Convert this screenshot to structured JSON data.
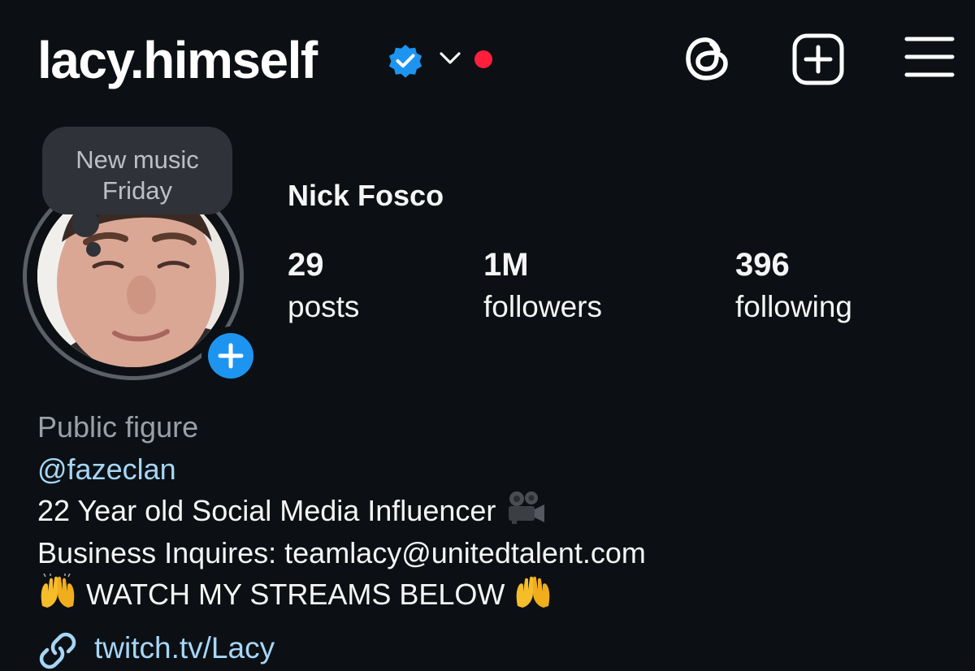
{
  "header": {
    "username": "lacy.himself",
    "icons": {
      "verified": "verified-badge-icon",
      "chevron": "chevron-down-icon",
      "threads": "threads-icon",
      "add": "add-content-icon",
      "menu": "hamburger-menu-icon"
    },
    "colors": {
      "verified": "#1d95f0",
      "notification_dot": "#ff1f3d"
    }
  },
  "profile": {
    "note": {
      "line1": "New music",
      "line2": "Friday"
    },
    "display_name": "Nick Fosco",
    "stats": [
      {
        "value": "29",
        "label": "posts"
      },
      {
        "value": "1M",
        "label": "followers"
      },
      {
        "value": "396",
        "label": "following"
      }
    ]
  },
  "bio": {
    "category": "Public figure",
    "mention": "@fazeclan",
    "line1": "22 Year old Social Media Influencer",
    "line2": "Business Inquires: teamlacy@unitedtalent.com",
    "line3": "WATCH MY STREAMS BELOW",
    "link": "twitch.tv/Lacy",
    "emoji": {
      "camera": "movie-camera-emoji",
      "hands": "raising-hands-emoji"
    }
  },
  "colors": {
    "background": "#0c1014",
    "link": "#a6d6f7",
    "secondary_text": "#9aa0a6",
    "add_story": "#1d95f0"
  }
}
